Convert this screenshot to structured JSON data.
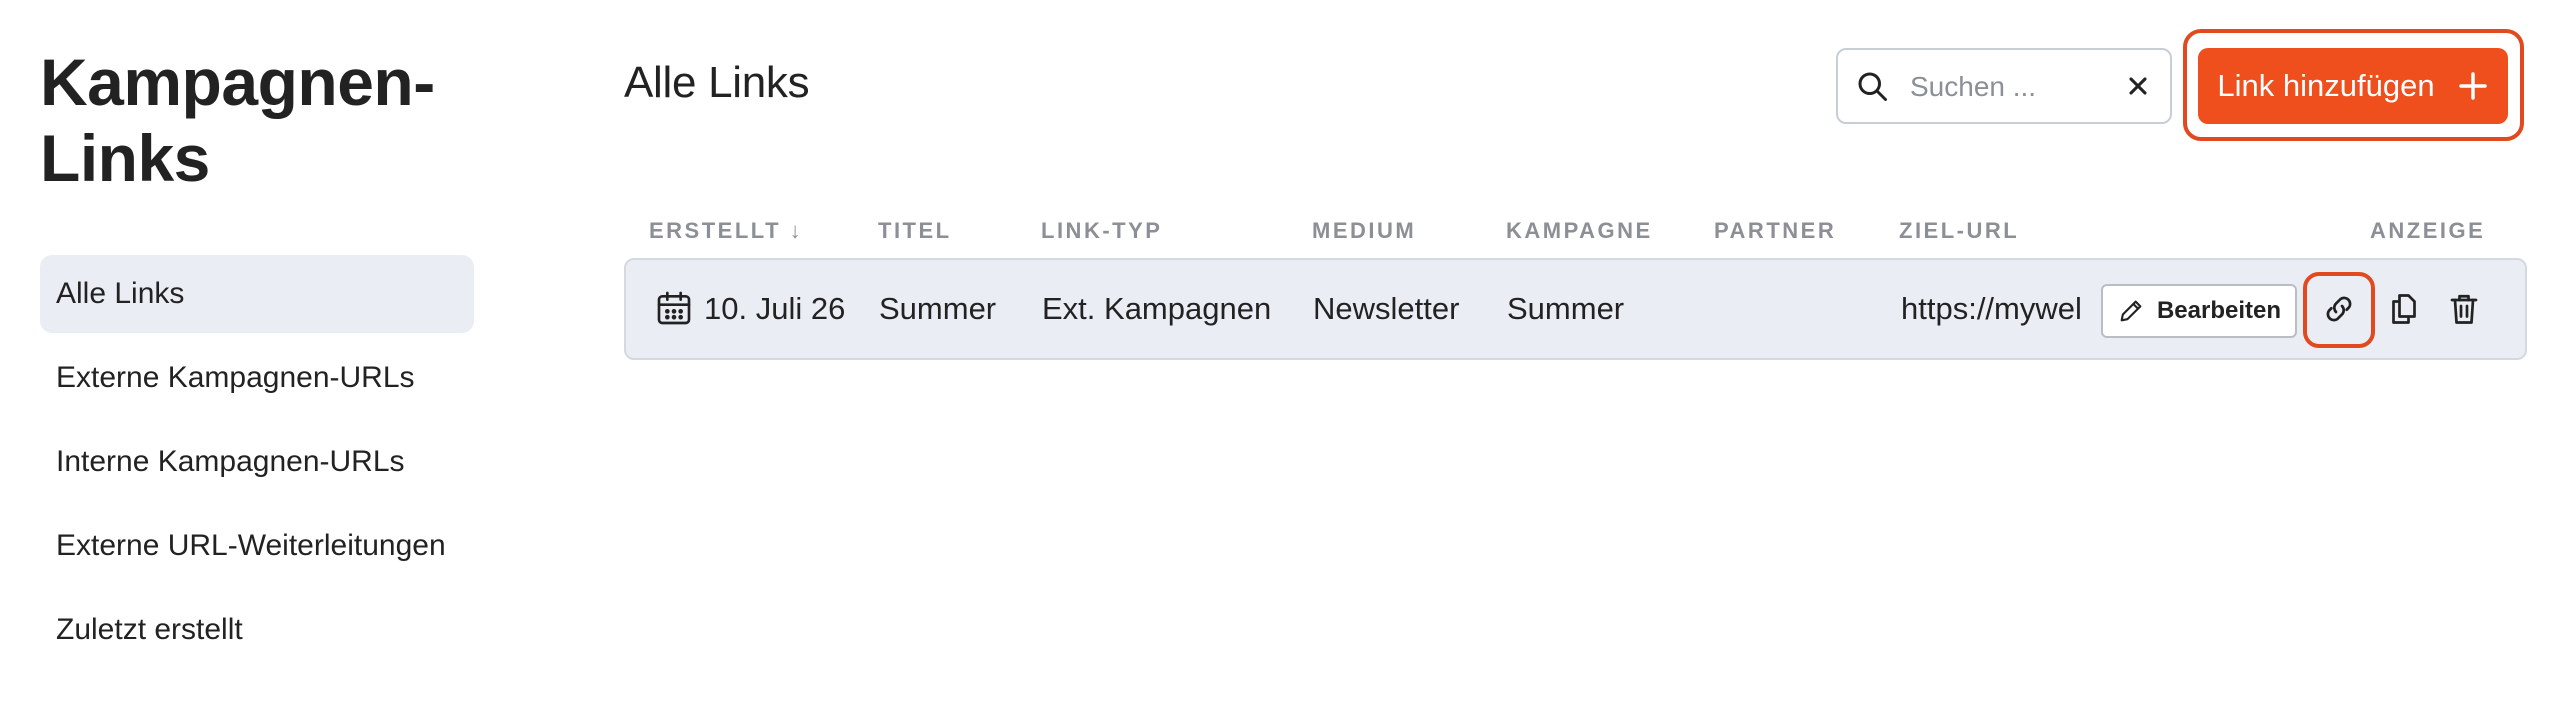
{
  "app": {
    "title": "Kampagnen-\nLinks"
  },
  "sidebar": {
    "items": [
      {
        "label": "Alle Links",
        "active": true
      },
      {
        "label": "Externe Kampagnen-URLs"
      },
      {
        "label": "Interne Kampagnen-URLs"
      },
      {
        "label": "Externe URL-Weiterleitungen"
      },
      {
        "label": "Zuletzt erstellt"
      }
    ]
  },
  "main": {
    "title": "Alle Links",
    "search": {
      "placeholder": "Suchen ...",
      "value": ""
    },
    "add_button": "Link hinzufügen",
    "columns": [
      "ERSTELLT ↓",
      "TITEL",
      "LINK-TYP",
      "MEDIUM",
      "KAMPAGNE",
      "PARTNER",
      "ZIEL-URL",
      "ANZEIGE"
    ],
    "rows": [
      {
        "created": "10. Juli 26",
        "title": "Summer",
        "link_type": "Ext. Kampagnen",
        "medium": "Newsletter",
        "campaign": "Summer",
        "partner": "",
        "target_url": "https://mywel",
        "edit_label": "Bearbeiten"
      }
    ]
  },
  "colors": {
    "accent": "#ee4f1d",
    "highlight_outline": "#e14a1f",
    "row_bg": "#eaeef4",
    "nav_active_bg": "#eaeef4",
    "header_text": "#8c8f95"
  },
  "icons": {
    "search": "search-icon",
    "clear": "close-icon",
    "add": "plus-icon",
    "created": "calendar-icon",
    "edit": "pencil-icon",
    "link": "link-icon",
    "copy": "copy-icon",
    "delete": "trash-icon"
  }
}
